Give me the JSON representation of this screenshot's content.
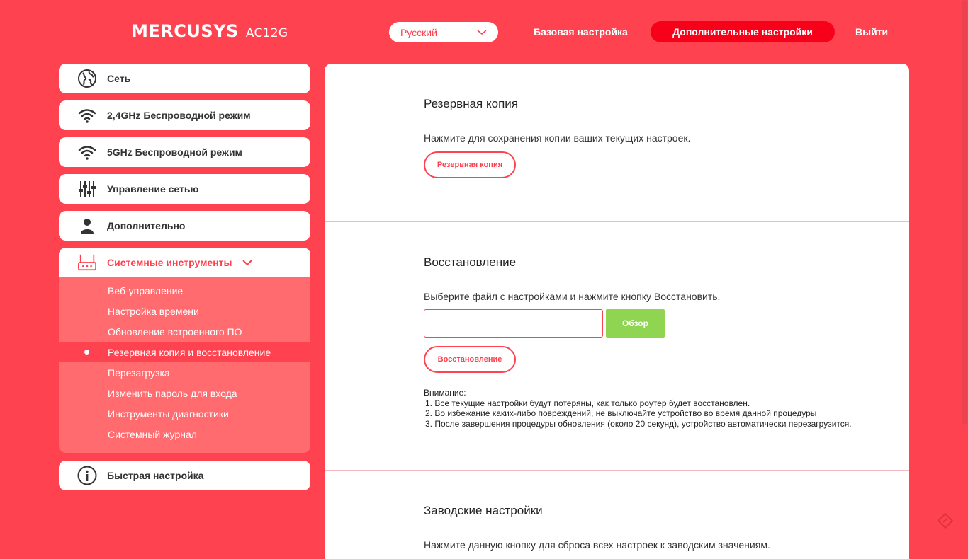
{
  "header": {
    "brand": "MERCUSYS",
    "model": "AC12G",
    "language": "Русский",
    "nav_basic": "Базовая настройка",
    "nav_advanced": "Дополнительные настройки",
    "nav_logout": "Выйти"
  },
  "sidebar": {
    "items": [
      {
        "label": "Сеть",
        "icon": "globe-icon"
      },
      {
        "label": "2,4GHz Беспроводной режим",
        "icon": "wifi-icon"
      },
      {
        "label": "5GHz Беспроводной режим",
        "icon": "wifi-icon"
      },
      {
        "label": "Управление сетью",
        "icon": "sliders-icon"
      },
      {
        "label": "Дополнительно",
        "icon": "user-icon"
      },
      {
        "label": "Системные инструменты",
        "icon": "router-icon"
      },
      {
        "label": "Быстрая настройка",
        "icon": "info-icon"
      }
    ],
    "submenu": [
      "Веб-управление",
      "Настройка времени",
      "Обновление встроенного ПО",
      "Резервная копия и восстановление",
      "Перезагрузка",
      "Изменить пароль для входа",
      "Инструменты диагностики",
      "Системный журнал"
    ]
  },
  "backup": {
    "title": "Резервная копия",
    "description": "Нажмите для сохранения копии ваших текущих настроек.",
    "button": "Резервная копия"
  },
  "restore": {
    "title": "Восстановление",
    "description": "Выберите файл с настройками и нажмите кнопку Восстановить.",
    "file_value": "",
    "browse_button": "Обзор",
    "button": "Восстановление",
    "notes_title": "Внимание:",
    "notes": [
      "1. Все текущие настройки будут потеряны, как только роутер будет восстановлен.",
      "2. Во избежание каких-либо повреждений, не выключайте устройство во время данной процедуры",
      "3. После завершения процедуры обновления (около 20 секунд), устройство автоматически перезагрузится."
    ]
  },
  "factory": {
    "title": "Заводские настройки",
    "description": "Нажмите данную кнопку для сброса всех настроек к заводским значениям."
  },
  "colors": {
    "background": "#ff4250",
    "accent": "#ff3e4c",
    "active_nav": "#f6001a",
    "submenu_bg": "#ff6b6f",
    "browse_green": "#8fd552"
  }
}
